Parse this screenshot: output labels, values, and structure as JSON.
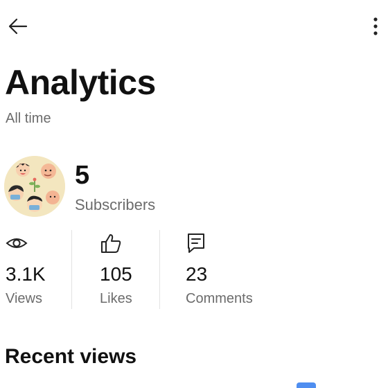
{
  "header": {
    "title": "Analytics",
    "subtitle": "All time",
    "back_icon": "arrow-left-icon",
    "more_icon": "more-vertical-icon"
  },
  "channel": {
    "subscriber_count": "5",
    "subscriber_label": "Subscribers"
  },
  "stats": [
    {
      "icon": "eye-icon",
      "value": "3.1K",
      "label": "Views"
    },
    {
      "icon": "thumbs-up-icon",
      "value": "105",
      "label": "Likes"
    },
    {
      "icon": "comment-icon",
      "value": "23",
      "label": "Comments"
    }
  ],
  "recent": {
    "title": "Recent views"
  },
  "colors": {
    "text": "#111111",
    "muted": "#6b6b6b",
    "divider": "#e2e2e2",
    "accent": "#4f8ef0",
    "avatar_bg": "#f3e6bf"
  }
}
